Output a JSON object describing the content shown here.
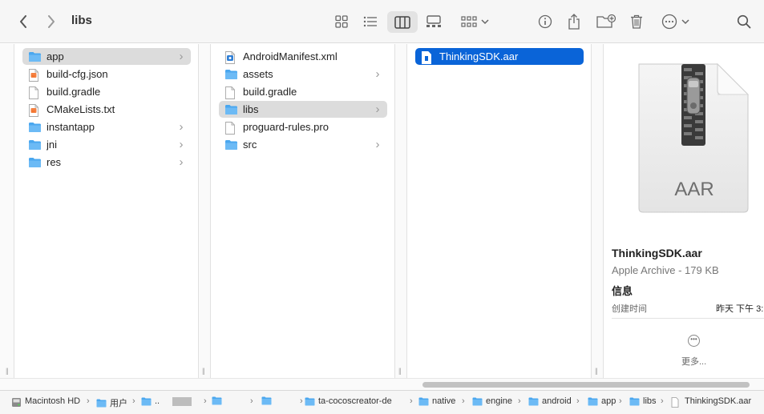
{
  "window": {
    "title": "libs"
  },
  "toolbar": {
    "back_icon": "chevron-left-icon",
    "forward_icon": "chevron-right-icon",
    "view_icons": [
      "grid-view-icon",
      "list-view-icon",
      "column-view-icon",
      "gallery-view-icon"
    ],
    "group_icon": "group-icon",
    "action_icons": [
      "info-icon",
      "share-icon",
      "new-folder-icon",
      "trash-icon",
      "more-icon",
      "search-icon"
    ]
  },
  "columns": {
    "app": [
      {
        "label": "app",
        "kind": "folder",
        "has_children": true,
        "selected": true
      },
      {
        "label": "build-cfg.json",
        "kind": "file-swift"
      },
      {
        "label": "build.gradle",
        "kind": "file"
      },
      {
        "label": "CMakeLists.txt",
        "kind": "file-swift"
      },
      {
        "label": "instantapp",
        "kind": "folder",
        "has_children": true
      },
      {
        "label": "jni",
        "kind": "folder",
        "has_children": true
      },
      {
        "label": "res",
        "kind": "folder",
        "has_children": true
      }
    ],
    "libs_parent": [
      {
        "label": "AndroidManifest.xml",
        "kind": "file-xml"
      },
      {
        "label": "assets",
        "kind": "folder",
        "has_children": true
      },
      {
        "label": "build.gradle",
        "kind": "file"
      },
      {
        "label": "libs",
        "kind": "folder",
        "has_children": true,
        "selected": true
      },
      {
        "label": "proguard-rules.pro",
        "kind": "file"
      },
      {
        "label": "src",
        "kind": "folder",
        "has_children": true
      }
    ],
    "libs": [
      {
        "label": "ThinkingSDK.aar",
        "kind": "file",
        "selected": true
      }
    ]
  },
  "preview": {
    "badge": "AAR",
    "name": "ThinkingSDK.aar",
    "kind": "Apple Archive - 179 KB",
    "info_heading": "信息",
    "created_label": "创建时间",
    "created_value": "昨天 下午 3:",
    "more_label": "更多..."
  },
  "pathbar": {
    "items": [
      {
        "label": "Macintosh HD",
        "icon": "disk-icon"
      },
      {
        "label": "用户",
        "icon": "folder-icon"
      },
      {
        "label": "..",
        "icon": "folder-icon"
      },
      {
        "label": "",
        "icon": "folder-icon"
      },
      {
        "label": "",
        "icon": "folder-icon"
      },
      {
        "label": "ta-cocoscreator-de",
        "icon": "folder-icon"
      },
      {
        "label": "native",
        "icon": "folder-icon"
      },
      {
        "label": "engine",
        "icon": "folder-icon"
      },
      {
        "label": "android",
        "icon": "folder-icon"
      },
      {
        "label": "app",
        "icon": "folder-icon"
      },
      {
        "label": "libs",
        "icon": "folder-icon"
      },
      {
        "label": "ThinkingSDK.aar",
        "icon": "file-icon"
      }
    ]
  },
  "colors": {
    "accent": "#0a64d8",
    "folder": "#4aa7ef",
    "selection_grey": "#dcdcdc"
  }
}
